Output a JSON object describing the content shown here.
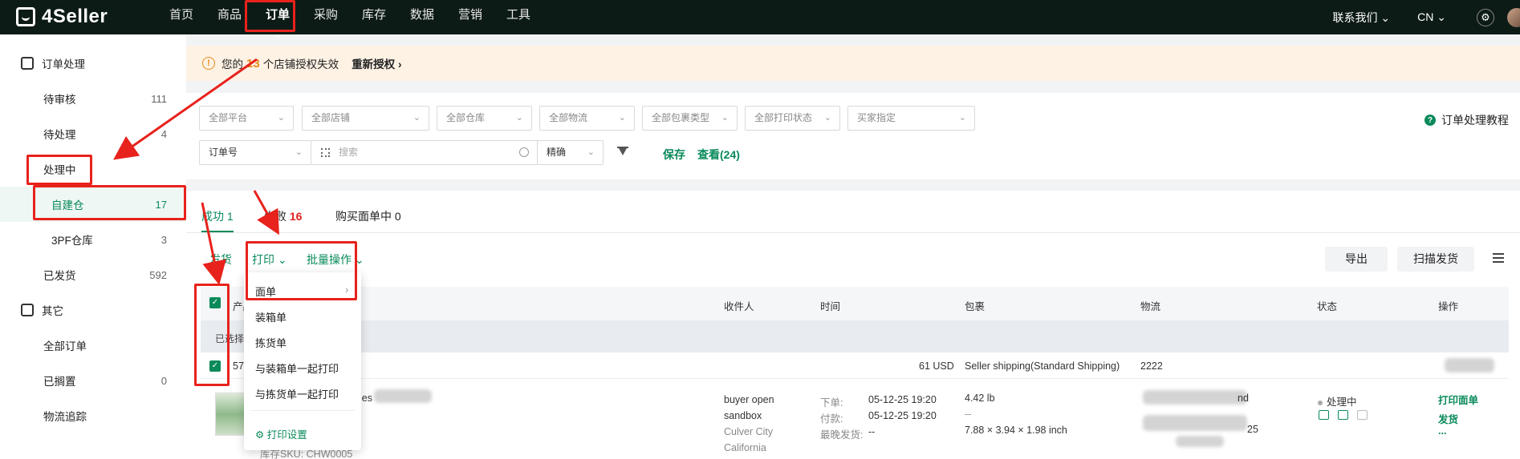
{
  "brand": {
    "name": "4Seller"
  },
  "nav": {
    "items": [
      "首页",
      "商品",
      "订单",
      "采购",
      "库存",
      "数据",
      "营销",
      "工具"
    ],
    "active_index": 2,
    "contact": "联系我们",
    "lang": "CN"
  },
  "sidebar": {
    "group1": "订单处理",
    "pending_review": {
      "label": "待审核",
      "count": "111"
    },
    "to_process": {
      "label": "待处理",
      "count": "4"
    },
    "processing": {
      "label": "处理中"
    },
    "self_warehouse": {
      "label": "自建仓",
      "count": "17"
    },
    "tpf_warehouse": {
      "label": "3PF仓库",
      "count": "3"
    },
    "shipped": {
      "label": "已发货",
      "count": "592"
    },
    "group2": "其它",
    "all_orders": {
      "label": "全部订单"
    },
    "shelved": {
      "label": "已搁置",
      "count": "0"
    },
    "tracking": {
      "label": "物流追踪"
    }
  },
  "warning": {
    "prefix": "您的",
    "count": "13",
    "suffix": "个店铺授权失效",
    "action": "重新授权"
  },
  "filters": {
    "platform": "全部平台",
    "store": "全部店铺",
    "warehouse": "全部仓库",
    "logistics": "全部物流",
    "package_type": "全部包裹类型",
    "print_status": "全部打印状态",
    "buyer_specified": "买家指定",
    "order_no": "订单号",
    "search_placeholder": "搜索",
    "match_mode": "精确",
    "save": "保存",
    "view": "查看(24)",
    "tutorial": "订单处理教程"
  },
  "tabs": {
    "success_label": "成功",
    "success_count": "1",
    "fail_label": "失败",
    "fail_count": "16",
    "buy_label": "购买面单中",
    "buy_count": "0"
  },
  "actions": {
    "ship": "发货",
    "print": "打印",
    "batch": "批量操作",
    "export": "导出",
    "scan_ship": "扫描发货"
  },
  "table": {
    "headers": {
      "product": "产品",
      "recipient": "收件人",
      "time": "时间",
      "package": "包裹",
      "logistics": "物流",
      "status": "状态",
      "operation": "操作"
    },
    "selected_text": "已选择",
    "row1": {
      "order_prefix": "576",
      "amount": "61 USD",
      "shipping": "Seller shipping(Standard Shipping)",
      "logistics_no": "2222"
    },
    "row2": {
      "product_fragment": "les",
      "sku": "库存SKU: CHW0005",
      "buyer_line1": "buyer open",
      "buyer_line2": "sandbox",
      "city": "Culver City",
      "state": "California",
      "order_label": "下单:",
      "order_time": "05-12-25 19:20",
      "paid_label": "付款:",
      "paid_time": "05-12-25 19:20",
      "latest_label": "最晚发货:",
      "latest_value": "--",
      "weight": "4.42 lb",
      "package_dash": "--",
      "dims": "7.88 × 3.94 × 1.98 inch",
      "logistics_frag1": "nd",
      "logistics_frag2": "25",
      "status": "处理中",
      "op_print": "打印面单",
      "op_ship": "发货",
      "op_more": "..."
    }
  },
  "print_menu": {
    "items": [
      "面单",
      "装箱单",
      "拣货单",
      "与装箱单一起打印",
      "与拣货单一起打印"
    ],
    "settings": "打印设置"
  },
  "colors": {
    "accent": "#0a8a5a",
    "topbar": "#0d1b17",
    "annotation": "#e8221c",
    "warning": "#e88a1a"
  }
}
